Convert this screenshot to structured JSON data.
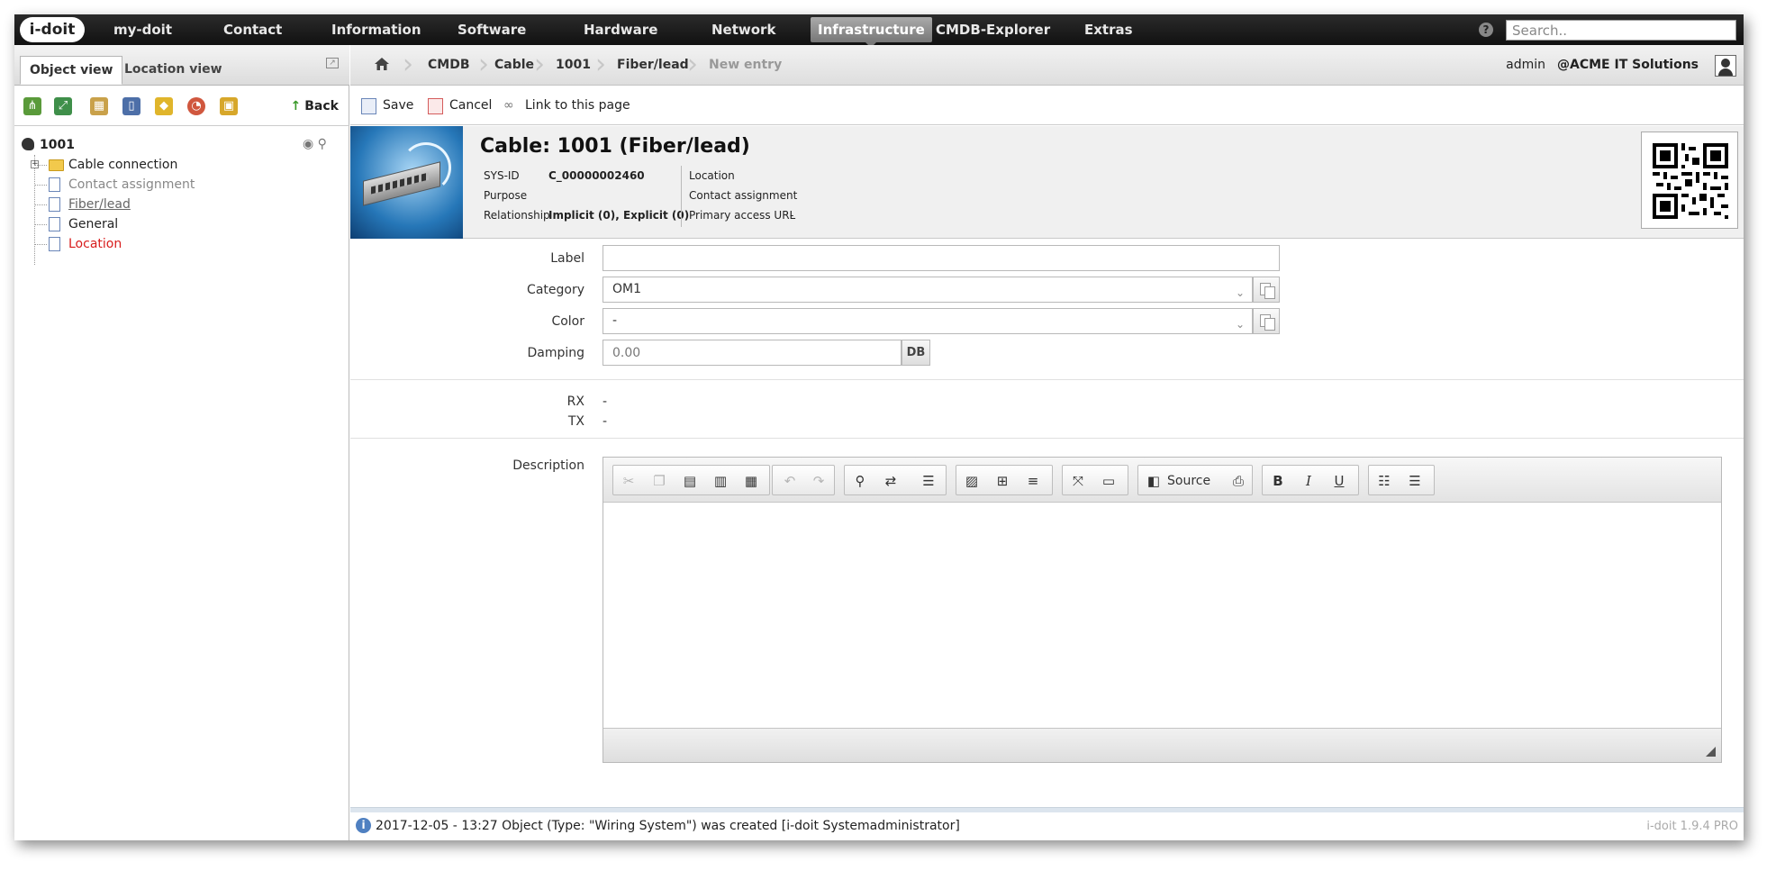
{
  "nav": {
    "logo_text": "i-doit",
    "items": [
      "my-doit",
      "Contact",
      "Information",
      "Software",
      "Hardware",
      "Network",
      "Infrastructure",
      "CMDB-Explorer",
      "Extras"
    ],
    "active": "Infrastructure",
    "search_placeholder": "Search.."
  },
  "left": {
    "tabs": [
      "Object view",
      "Location view"
    ],
    "active_tab": "Object view",
    "back_label": "Back",
    "tree": {
      "root": "1001",
      "items": [
        {
          "label": "Cable connection",
          "state": "folder"
        },
        {
          "label": "Contact assignment",
          "state": "empty"
        },
        {
          "label": "Fiber/lead",
          "state": "current"
        },
        {
          "label": "General",
          "state": "normal"
        },
        {
          "label": "Location",
          "state": "missing"
        }
      ]
    }
  },
  "breadcrumb": {
    "items": [
      "CMDB",
      "Cable",
      "1001",
      "Fiber/lead",
      "New entry"
    ],
    "user": "admin",
    "tenant": "@ACME IT Solutions"
  },
  "actions": {
    "save": "Save",
    "cancel": "Cancel",
    "link": "Link to this page"
  },
  "object": {
    "title": "Cable: 1001 (Fiber/lead)",
    "sys_id_label": "SYS-ID",
    "sys_id_value": "C_00000002460",
    "purpose_label": "Purpose",
    "purpose_value": "",
    "relationship_label": "Relationship",
    "relationship_value": "Implicit (0), Explicit (0)",
    "location_label": "Location",
    "contact_label": "Contact assignment",
    "primary_url_label": "Primary access URL",
    "primary_url_value": "-"
  },
  "form": {
    "label_label": "Label",
    "label_value": "",
    "category_label": "Category",
    "category_value": "OM1",
    "color_label": "Color",
    "color_value": "-",
    "damping_label": "Damping",
    "damping_value": "0.00",
    "damping_unit": "DB",
    "rx_label": "RX",
    "rx_value": "-",
    "tx_label": "TX",
    "tx_value": "-",
    "description_label": "Description",
    "source_label": "Source"
  },
  "status": {
    "message": "2017-12-05 - 13:27 Object (Type: \"Wiring System\") was created [i-doit Systemadministrator]",
    "version": "i-doit 1.9.4 PRO"
  }
}
